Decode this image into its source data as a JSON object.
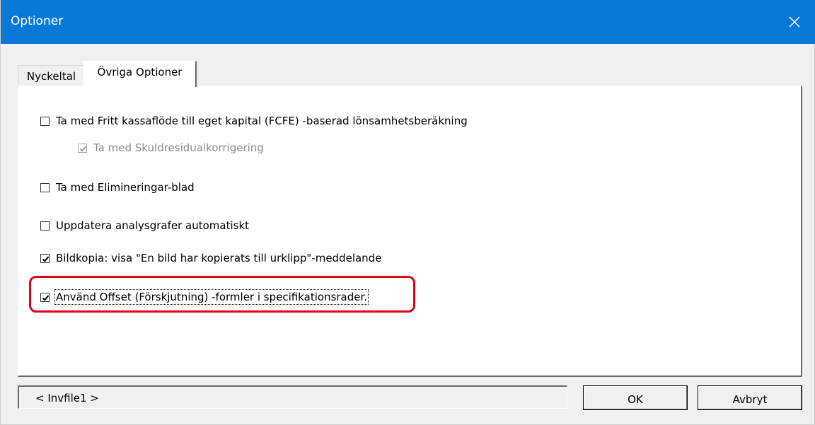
{
  "window": {
    "title": "Optioner",
    "close_icon": "close-icon"
  },
  "tabs": [
    {
      "label": "Nyckeltal",
      "active": false
    },
    {
      "label": "Övriga Optioner",
      "active": true
    }
  ],
  "options": [
    {
      "label": "Ta med Fritt kassaflöde till eget kapital (FCFE) -baserad lönsamhetsberäkning",
      "checked": false,
      "enabled": true
    },
    {
      "label": "Ta med Skuldresidualkorrigering",
      "checked": true,
      "enabled": false
    },
    {
      "label": "Ta med Elimineringar-blad",
      "checked": false,
      "enabled": true
    },
    {
      "label": "Uppdatera analysgrafer automatiskt",
      "checked": false,
      "enabled": true
    },
    {
      "label": "Bildkopia: visa \"En bild har kopierats till urklipp\"-meddelande",
      "checked": true,
      "enabled": true
    },
    {
      "label": "Använd Offset (Förskjutning) -formler i specifikationsrader.",
      "checked": true,
      "enabled": true,
      "focused": true
    }
  ],
  "status": {
    "text": "< Invfile1 >"
  },
  "buttons": {
    "ok": "OK",
    "cancel": "Avbryt"
  },
  "colors": {
    "titlebar": "#0a78d7",
    "highlight": "#e0001a"
  }
}
